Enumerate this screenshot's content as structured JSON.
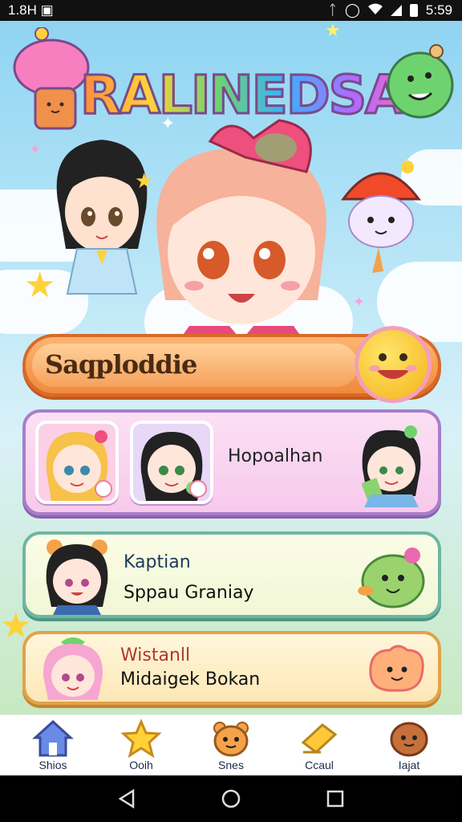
{
  "status_bar": {
    "left_text": "1.8H",
    "left_icon": "gallery-icon",
    "time": "5:59",
    "icons": [
      "bluetooth-icon",
      "vibrate-icon",
      "wifi-icon",
      "signal-icon",
      "battery-icon"
    ]
  },
  "header": {
    "logo_text": "RALINEDSAI"
  },
  "search": {
    "label": "Saqploddie",
    "button_icon": "smiley-face-icon"
  },
  "cards": [
    {
      "title": "Hopoalhan",
      "subtitle": ""
    },
    {
      "title": "Kaptian",
      "subtitle": "Sppau Graniay"
    },
    {
      "title": "Wistanll",
      "subtitle": "Midaigek Bokan"
    }
  ],
  "bottom_nav": [
    {
      "label": "Shios",
      "icon": "house-icon"
    },
    {
      "label": "Ooih",
      "icon": "star-icon"
    },
    {
      "label": "Snes",
      "icon": "bear-face-icon"
    },
    {
      "label": "Ccaul",
      "icon": "ticket-icon"
    },
    {
      "label": "Iajat",
      "icon": "potato-face-icon"
    }
  ],
  "colors": {
    "accent_orange": "#f08a3a",
    "card_purple": "#a67ec8",
    "card_teal": "#6fb6a2",
    "card_orange": "#e2a24a",
    "sky": "#8fd4f2"
  }
}
